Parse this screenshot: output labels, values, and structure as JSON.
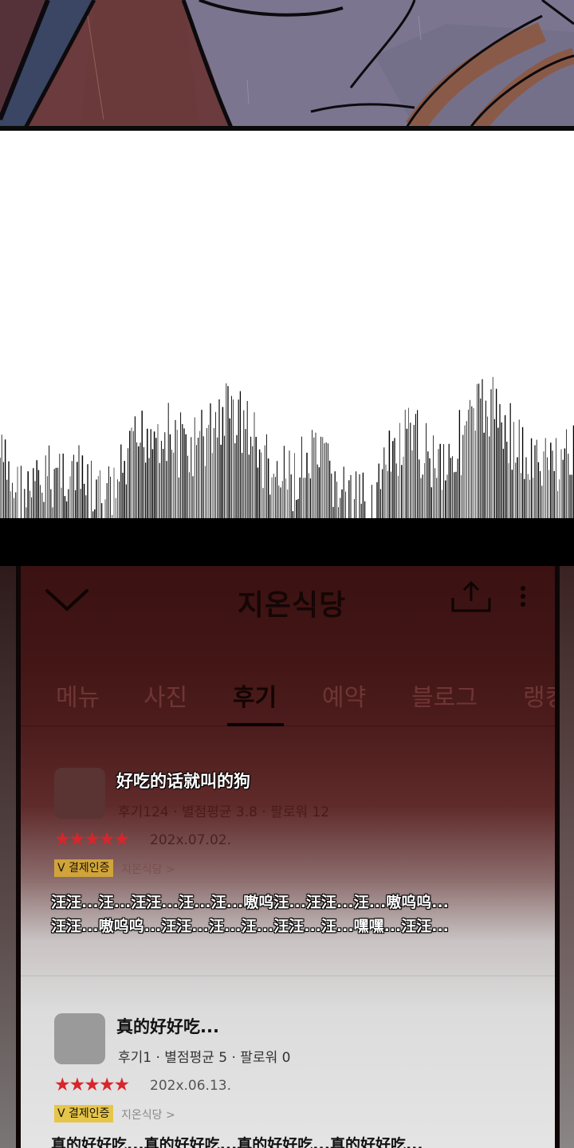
{
  "colors": {
    "accent_star": "#d8252c",
    "badge": "#e6c64a",
    "header_bg": "#3b1111",
    "list_bg": "#e4e4e4"
  },
  "header": {
    "back_icon": "chevron-down-icon",
    "title": "지온식당",
    "share_icon": "share-icon",
    "more_icon": "more-vertical-icon"
  },
  "tabs": [
    {
      "label": "메뉴",
      "active": false
    },
    {
      "label": "사진",
      "active": false
    },
    {
      "label": "후기",
      "active": true
    },
    {
      "label": "예약",
      "active": false
    },
    {
      "label": "블로그",
      "active": false
    },
    {
      "label": "랭킹",
      "active": false
    }
  ],
  "reviews": [
    {
      "title": "好吃的话就叫的狗",
      "meta": "후기124 · 별점평균 3.8 · 팔로워 12",
      "stars": "★★★★★",
      "rating": 5,
      "date": "202x.07.02.",
      "badge": "V 결제인증",
      "store": "지온식당 >",
      "body_lines": [
        "汪汪...汪...汪汪...汪...汪...嗷呜汪...汪汪...汪...嗷呜呜...",
        "汪汪...嗷呜呜...汪汪...汪...汪...汪汪...汪...嘿嘿...汪汪..."
      ]
    },
    {
      "title": "真的好好吃...",
      "meta": "후기1 · 별점평균 5 · 팔로워 0",
      "stars": "★★★★★",
      "rating": 5,
      "date": "202x.06.13.",
      "badge": "V 결제인증",
      "store": "지온식당 >",
      "body_lines": [
        "真的好好吃...真的好好吃...真的好好吃...真的好好吃..."
      ]
    }
  ]
}
